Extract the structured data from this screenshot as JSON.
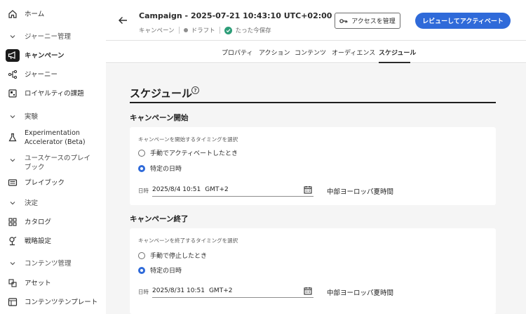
{
  "sidebar": {
    "items": [
      {
        "label": "ホーム",
        "icon": "home-icon",
        "type": "item"
      },
      {
        "label": "ジャーニー管理",
        "icon": "chevron-down-icon",
        "type": "section"
      },
      {
        "label": "キャンペーン",
        "icon": "megaphone-icon",
        "type": "item",
        "active": true
      },
      {
        "label": "ジャーニー",
        "icon": "journey-icon",
        "type": "item"
      },
      {
        "label": "ロイヤルティの課題",
        "icon": "loyalty-icon",
        "type": "item"
      },
      {
        "label": "実験",
        "icon": "chevron-down-icon",
        "type": "section"
      },
      {
        "label": "Experimentation Accelerator (Beta)",
        "label_line1": "Experimentation",
        "label_line2": "Accelerator (Beta)",
        "icon": "flask-icon",
        "type": "item"
      },
      {
        "label": "ユースケースのプレイブック",
        "label_line1": "ユースケースのプレイ",
        "label_line2": "ブック",
        "icon": "chevron-down-icon",
        "type": "section"
      },
      {
        "label": "プレイブック",
        "icon": "playbook-icon",
        "type": "item"
      },
      {
        "label": "決定",
        "icon": "chevron-down-icon",
        "type": "section"
      },
      {
        "label": "カタログ",
        "icon": "catalog-icon",
        "type": "item"
      },
      {
        "label": "戦略設定",
        "icon": "strategy-icon",
        "type": "item"
      },
      {
        "label": "コンテンツ管理",
        "icon": "chevron-down-icon",
        "type": "section"
      },
      {
        "label": "アセット",
        "icon": "assets-icon",
        "type": "item"
      },
      {
        "label": "コンテンツテンプレート",
        "icon": "template-icon",
        "type": "item"
      }
    ]
  },
  "header": {
    "title": "Campaign - 2025-07-21 10:43:10 UTC+02:00",
    "type": "キャンペーン",
    "status": "ドラフト",
    "saved": "たった今保存",
    "access_button": "アクセスを管理",
    "review_button": "レビューしてアクティベート"
  },
  "tabs": [
    {
      "label": "プロパティ"
    },
    {
      "label": "アクション"
    },
    {
      "label": "コンテンツ"
    },
    {
      "label": "オーディエンス"
    },
    {
      "label": "スケジュール",
      "selected": true
    }
  ],
  "schedule": {
    "title": "スケジュール",
    "start": {
      "section_title": "キャンペーン開始",
      "hint": "キャンペーンを開始するタイミングを選択",
      "option_manual": "手動でアクティベートしたとき",
      "option_specific": "特定の日時",
      "selected": "specific",
      "date_label": "日時",
      "date_value": "2025/8/4 10:51",
      "date_tz": "GMT+2",
      "timezone_name": "中部ヨーロッパ夏時間"
    },
    "end": {
      "section_title": "キャンペーン終了",
      "hint": "キャンペーンを終了するタイミングを選択",
      "option_manual": "手動で停止したとき",
      "option_specific": "特定の日時",
      "selected": "specific",
      "date_label": "日時",
      "date_value": "2025/8/31 10:51",
      "date_tz": "GMT+2",
      "timezone_name": "中部ヨーロッパ夏時間"
    }
  },
  "colors": {
    "accent": "#2f6ad9",
    "saved_check": "#2d9d78"
  }
}
